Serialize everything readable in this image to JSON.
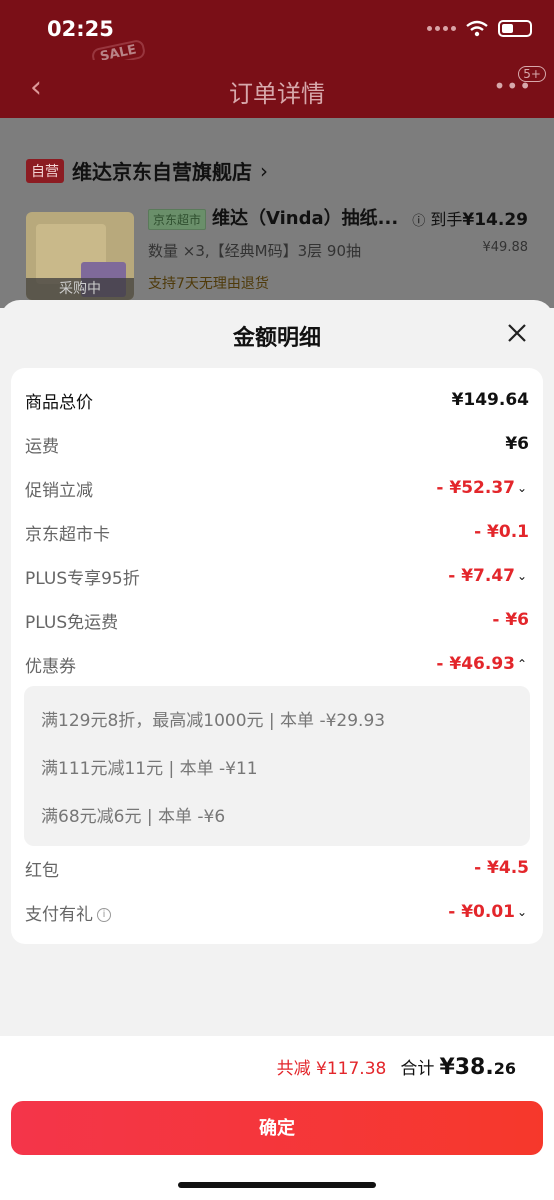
{
  "status_bar": {
    "time": "02:25"
  },
  "nav": {
    "title": "订单详情",
    "more_badge": "5+",
    "sale_tag": "SALE"
  },
  "order": {
    "self_badge": "自营",
    "shop_name": "维达京东自营旗舰店",
    "product_tag": "京东超市",
    "product_name": "维达（Vinda）抽纸...",
    "arrive_label": "到手",
    "arrive_price": "¥14.29",
    "original_price": "¥49.88",
    "spec": "数量 ×3,【经典M码】3层 90抽",
    "return_policy": "支持7天无理由退货",
    "buying_label": "采购中"
  },
  "sheet": {
    "title": "金额明细",
    "rows": {
      "total_goods": {
        "label": "商品总价",
        "value": "¥149.64"
      },
      "shipping": {
        "label": "运费",
        "value": "¥6"
      },
      "promo": {
        "label": "促销立减",
        "value": "- ¥52.37"
      },
      "jd_card": {
        "label": "京东超市卡",
        "value": "- ¥0.1"
      },
      "plus_discount": {
        "label": "PLUS专享95折",
        "value": "- ¥7.47"
      },
      "plus_shipping": {
        "label": "PLUS免运费",
        "value": "- ¥6"
      },
      "coupon": {
        "label": "优惠券",
        "value": "- ¥46.93"
      },
      "red_packet": {
        "label": "红包",
        "value": "- ¥4.5"
      },
      "pay_gift": {
        "label": "支付有礼",
        "value": "- ¥0.01"
      }
    },
    "coupon_details": [
      "满129元8折，最高减1000元 | 本单 -¥29.93",
      "满111元减11元 | 本单 -¥11",
      "满68元减6元 | 本单 -¥6"
    ],
    "footer": {
      "saved": "共减 ¥117.38",
      "total_label": "合计",
      "total_currency": "¥",
      "total_int": "38.",
      "total_dec": "26",
      "confirm": "确定"
    }
  },
  "colors": {
    "accent_red": "#e3262b",
    "nav_bg": "#7a0f17"
  }
}
